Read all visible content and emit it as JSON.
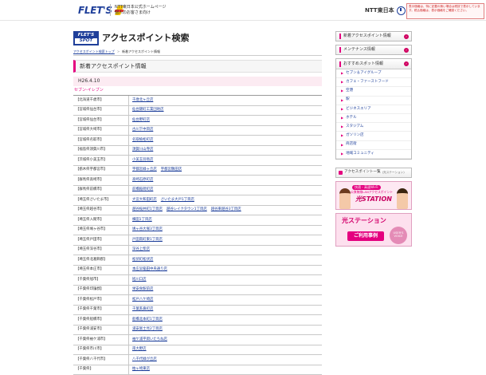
{
  "header": {
    "logo_text": "FLET'S",
    "line1": "NTT東日本公式ホームページ",
    "line2": "個人のお客さま向け",
    "ntt_text": "NTT東日本",
    "notice": "表示価格は、特に記載の無い場合は税抜で表示しています。税込価格は、表示価格をご確認ください。"
  },
  "title": {
    "logo_line1": "FLET'S",
    "logo_line2": "SPOT",
    "page_title": "アクセスポイント検索"
  },
  "breadcrumb": {
    "items": [
      "アクセスポイント検索トップ",
      "新着アクセスポイント情報"
    ],
    "separator": ">"
  },
  "main": {
    "section_title": "新着アクセスポイント情報",
    "date": "H26.4.10",
    "group": "セブン-イレブン",
    "rows": [
      {
        "pref": "【北海道千歳市】",
        "stores": [
          "千歳北ヶ丘店"
        ]
      },
      {
        "pref": "【宮城県仙台市】",
        "stores": [
          "仙台錦町工業団地店"
        ]
      },
      {
        "pref": "【宮城県仙台市】",
        "stores": [
          "仙台野町店"
        ]
      },
      {
        "pref": "【宮城県大崎市】",
        "stores": [
          "古川下中目店"
        ]
      },
      {
        "pref": "【宮城県名取市】",
        "stores": [
          "名取植松町店"
        ]
      },
      {
        "pref": "【福島県須賀川市】",
        "stores": [
          "須賀川山寺店"
        ]
      },
      {
        "pref": "【茨城県小美玉市】",
        "stores": [
          "小美玉羽鳥店"
        ]
      },
      {
        "pref": "【栃木県宇都宮市】",
        "stores": [
          "宇都宮緑ヶ丘店",
          "宇都宮鶴田店"
        ]
      },
      {
        "pref": "【群馬県高崎市】",
        "stores": [
          "高崎石原町店"
        ]
      },
      {
        "pref": "【群馬県前橋市】",
        "stores": [
          "前橋稲荷町店"
        ]
      },
      {
        "pref": "【埼玉県さいたま市】",
        "stores": [
          "大宮大和田町店",
          "さいたま大戸1丁目店"
        ]
      },
      {
        "pref": "【埼玉県越谷市】",
        "stores": [
          "越谷桜井町1丁目店",
          "越谷レイクタウン1丁目店",
          "越谷東越谷3丁目店"
        ]
      },
      {
        "pref": "【埼玉県入間市】",
        "stores": [
          "横田1丁目店"
        ]
      },
      {
        "pref": "【埼玉県鳩ヶ谷市】",
        "stores": [
          "鳩ヶ谷大塚3丁目店"
        ]
      },
      {
        "pref": "【埼玉県戸田市】",
        "stores": [
          "戸田南町東1丁目店"
        ]
      },
      {
        "pref": "【埼玉県深谷市】",
        "stores": [
          "深谷上柴店"
        ]
      },
      {
        "pref": "【埼玉県北葛飾郡】",
        "stores": [
          "松伏町松伏店"
        ]
      },
      {
        "pref": "【埼玉県本庄市】",
        "stores": [
          "本庄早稲田中央通り店"
        ]
      },
      {
        "pref": "【千葉県旭市】",
        "stores": [
          "旭川口店"
        ]
      },
      {
        "pref": "【千葉県印旛郡】",
        "stores": [
          "栄安食駅前店"
        ]
      },
      {
        "pref": "【千葉県松戸市】",
        "stores": [
          "松戸八ケ崎店"
        ]
      },
      {
        "pref": "【千葉県千葉市】",
        "stores": [
          "千葉亥鼻町店"
        ]
      },
      {
        "pref": "【千葉県船橋市】",
        "stores": [
          "船橋北本町1丁目店"
        ]
      },
      {
        "pref": "【千葉県浦安市】",
        "stores": [
          "浦安富士見2丁目店"
        ]
      },
      {
        "pref": "【千葉県袖ケ浦市】",
        "stores": [
          "袖ケ浦平岡いたちね店"
        ]
      },
      {
        "pref": "【千葉県市川市】",
        "stores": [
          "南大野店"
        ]
      },
      {
        "pref": "【千葉県八千代市】",
        "stores": [
          "八千代緑が丘店"
        ]
      },
      {
        "pref": "【千葉県】",
        "stores": [
          "柏ヶ崎東店"
        ]
      }
    ]
  },
  "sidebar": {
    "new_ap": "新着アクセスポイント情報",
    "maintenance": "メンテナンス情報",
    "recommend": "おすすめスポット情報",
    "spot_items": [
      "セブン＆アイグループ",
      "カフェ・ファーストフード",
      "空港",
      "駅",
      "ビジネスエリア",
      "ホテル",
      "スタジアム",
      "ガソリン店",
      "商店街",
      "地域コミュニティ"
    ],
    "ap_list": "アクセスポイント一覧",
    "ap_list_sub": "(光ステーション)",
    "banner1": {
      "badge": "快適・高速Wi-Fi",
      "sub": "公衆無線LANアクセスポイント",
      "name": "光STATION"
    },
    "banner2": {
      "title": "光ステーション",
      "sub": "ご利用事例",
      "voice": "USER'S VOICE"
    }
  },
  "colors": {
    "accent": "#e4007f",
    "link": "#1a3c99",
    "brand": "#1f3f9a"
  }
}
